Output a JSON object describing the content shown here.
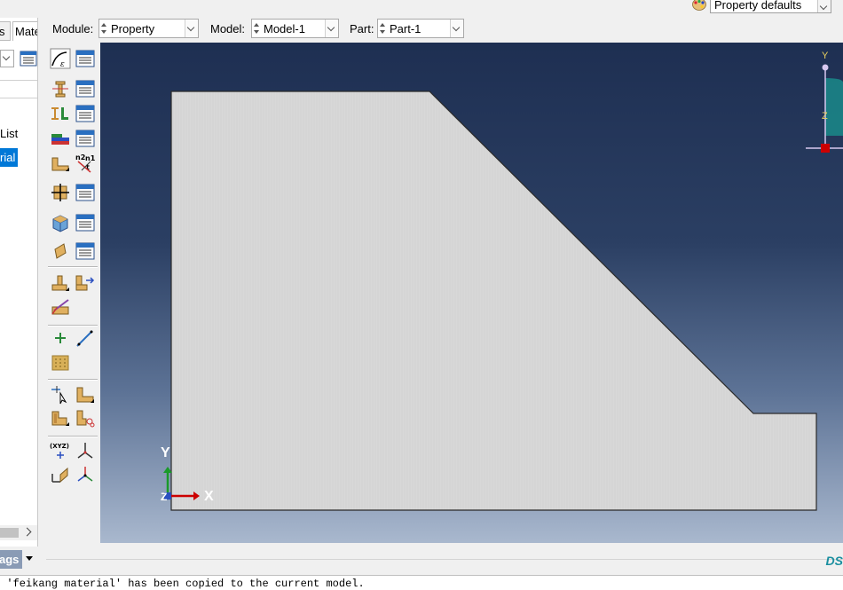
{
  "style_bar": {
    "value": "Property defaults",
    "icon": "palette-icon"
  },
  "context": {
    "module_label": "Module:",
    "module_value": "Property",
    "model_label": "Model:",
    "model_value": "Model-1",
    "part_label": "Part:",
    "part_value": "Part-1"
  },
  "tree": {
    "tabs": [
      "s",
      "Mate"
    ],
    "list_label": "List",
    "selected_item": "rial"
  },
  "toolbox": {
    "tools": [
      "create-material-icon",
      "material-manager-icon",
      "create-section-icon",
      "section-manager-icon",
      "create-profile-icon",
      "profile-manager-icon",
      "create-composite-layup-icon",
      "composite-layup-manager-icon",
      "assign-section-icon",
      "assign-beam-orientation-icon",
      "assign-material-orientation-icon",
      "orientation-manager-icon",
      "create-skin-icon",
      "skin-manager-icon",
      "create-stringer-icon",
      "stringer-manager-icon",
      "special-inertia-icon",
      "special-springs-icon",
      "assign-rebar-icon",
      "create-datum-point-icon",
      "create-datum-axis-icon",
      "create-datum-plane-icon",
      "partition-face-icon",
      "partition-cell-icon",
      "partition-edge-icon",
      "virtual-topology-icon",
      "create-datum-csys-icon",
      "create-datum-csys-manager-icon",
      "query-icon",
      "view-manipulation-icon"
    ]
  },
  "viewport": {
    "triad": {
      "x": "X",
      "y": "Y",
      "z": "Z"
    },
    "view_triad": {
      "y": "Y",
      "z": "Z"
    },
    "part_color": "#d6d6d6",
    "background_top": "#1e2f52",
    "background_bottom": "#a9b8ce"
  },
  "prompt": {
    "flags_label": "ags"
  },
  "message": {
    "text": "l 'feikang material' has been copied to the current model."
  },
  "brand": {
    "logo": "DS"
  }
}
